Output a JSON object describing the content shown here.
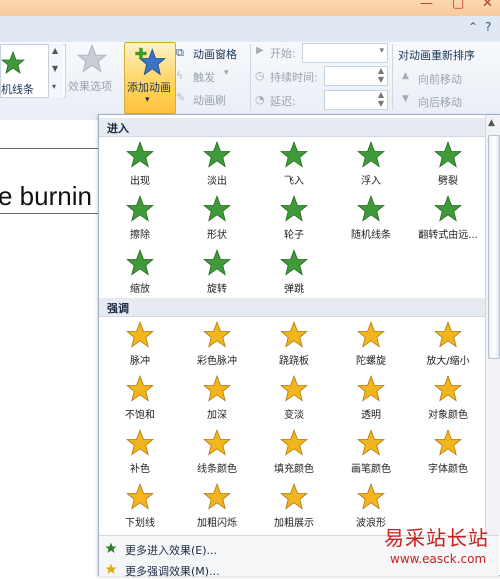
{
  "ribbon": {
    "gallery_label": "机线条",
    "effect_options": "效果选项",
    "add_animation": "添加动画",
    "animation_pane": "动画窗格",
    "trigger": "触发",
    "animation_painter": "动画刷",
    "start_label": "开始:",
    "duration_label": "持续时间:",
    "delay_label": "延迟:",
    "reorder_title": "对动画重新排序",
    "move_earlier": "向前移动",
    "move_later": "向后移动"
  },
  "document": {
    "visible_text": "e burnin"
  },
  "dropdown": {
    "entrance": {
      "title": "进入",
      "items": [
        "出现",
        "淡出",
        "飞入",
        "浮入",
        "劈裂",
        "擦除",
        "形状",
        "轮子",
        "随机线条",
        "翻转式由远...",
        "缩放",
        "旋转",
        "弹跳"
      ]
    },
    "emphasis": {
      "title": "强调",
      "items": [
        "脉冲",
        "彩色脉冲",
        "跷跷板",
        "陀螺旋",
        "放大/缩小",
        "不饱和",
        "加深",
        "变淡",
        "透明",
        "对象颜色",
        "补色",
        "线条颜色",
        "填充颜色",
        "画笔颜色",
        "字体颜色",
        "下划线",
        "加粗闪烁",
        "加粗展示",
        "波浪形"
      ]
    },
    "more_entrance": "更多进入效果(E)...",
    "more_emphasis": "更多强调效果(M)..."
  },
  "colors": {
    "entrance_star": "#3f9a3a",
    "emphasis_star": "#f2b51e",
    "ribbon_text": "#1c3557"
  },
  "watermark": {
    "text": "易采站长站",
    "url": "www.easck.com"
  }
}
